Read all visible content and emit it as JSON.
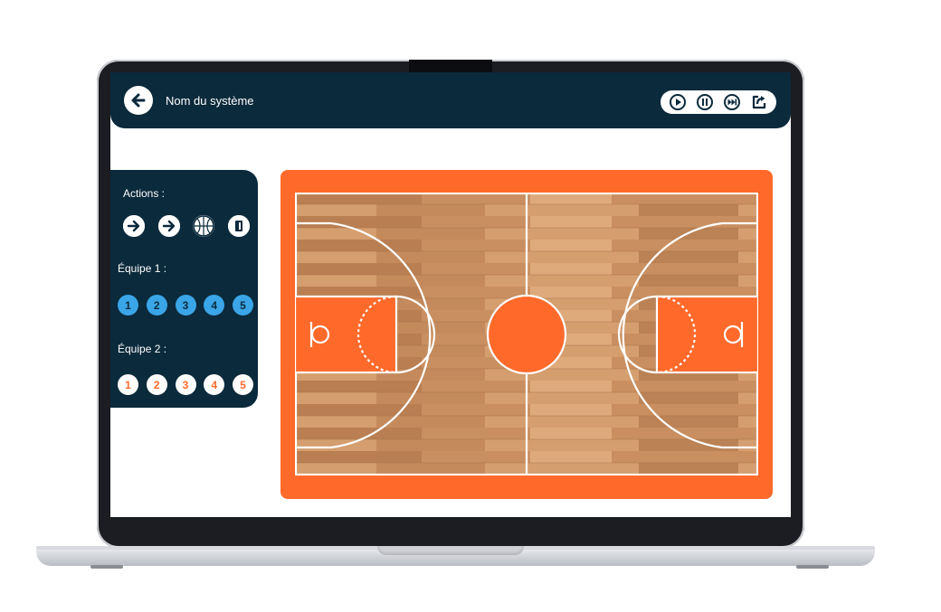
{
  "header": {
    "title": "Nom du système",
    "back_icon": "arrow-left-icon",
    "controls": [
      "play-icon",
      "pause-icon",
      "fast-forward-icon",
      "share-icon"
    ]
  },
  "sidebar": {
    "actions_label": "Actions :",
    "actions": [
      "arrow-right-icon",
      "arrow-right-icon",
      "basketball-icon",
      "screen-block-icon"
    ],
    "team1_label": "Équipe 1 :",
    "team1_players": [
      "1",
      "2",
      "3",
      "4",
      "5"
    ],
    "team2_label": "Équipe 2 :",
    "team2_players": [
      "1",
      "2",
      "3",
      "4",
      "5"
    ]
  },
  "colors": {
    "navy": "#0b2a3c",
    "orange": "#ff6a2b",
    "team1_blue": "#3aa6e8",
    "wood": "#c78d5e"
  }
}
